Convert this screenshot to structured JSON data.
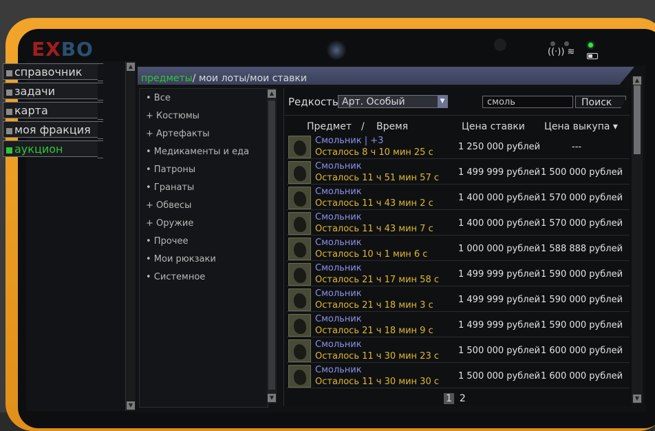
{
  "brand": {
    "logo_text_1": "EX",
    "logo_text_2": "BO"
  },
  "nav": {
    "items": [
      {
        "label": "справочник",
        "active": false
      },
      {
        "label": "задачи",
        "active": false
      },
      {
        "label": "карта",
        "active": false
      },
      {
        "label": "моя фракция",
        "active": false
      },
      {
        "label": "аукцион",
        "active": true
      }
    ]
  },
  "tabs": {
    "items": "предметы",
    "my_lots": "мои лоты",
    "my_bids": "мои ставки",
    "separator": "/"
  },
  "categories": [
    "• Все",
    "+ Костюмы",
    "+ Артефакты",
    "• Медикаменты и еда",
    "• Патроны",
    "• Гранаты",
    "+ Обвесы",
    "+ Оружие",
    "• Прочее",
    "• Мои рюкзаки",
    "• Системное"
  ],
  "filters": {
    "rarity_label": "Редкость",
    "rarity_value": "Арт. Особый",
    "search_value": "смоль",
    "search_button": "Поиск"
  },
  "table": {
    "headers": {
      "item": "Предмет",
      "slash": "/",
      "time": "Время",
      "bid": "Цена ставки",
      "buyout": "Цена выкупа ▾"
    },
    "rows": [
      {
        "name": "Смольник | +3",
        "time": "Осталось 8 ч 10 мин 25 с",
        "bid": "1 250 000 рублей",
        "buyout": "---"
      },
      {
        "name": "Смольник",
        "time": "Осталось 11 ч 51 мин 57 с",
        "bid": "1 499 999 рублей",
        "buyout": "1 500 000 рублей"
      },
      {
        "name": "Смольник",
        "time": "Осталось 11 ч 43 мин 2 с",
        "bid": "1 400 000 рублей",
        "buyout": "1 570 000 рублей"
      },
      {
        "name": "Смольник",
        "time": "Осталось 11 ч 43 мин 7 с",
        "bid": "1 400 000 рублей",
        "buyout": "1 570 000 рублей"
      },
      {
        "name": "Смольник",
        "time": "Осталось 10 ч 1 мин 6 с",
        "bid": "1 000 000 рублей",
        "buyout": "1 588 888 рублей"
      },
      {
        "name": "Смольник",
        "time": "Осталось 21 ч 17 мин 58 с",
        "bid": "1 499 999 рублей",
        "buyout": "1 590 000 рублей"
      },
      {
        "name": "Смольник",
        "time": "Осталось 21 ч 18 мин 3 с",
        "bid": "1 499 999 рублей",
        "buyout": "1 590 000 рублей"
      },
      {
        "name": "Смольник",
        "time": "Осталось 21 ч 18 мин 9 с",
        "bid": "1 499 999 рублей",
        "buyout": "1 590 000 рублей"
      },
      {
        "name": "Смольник",
        "time": "Осталось 11 ч 30 мин 23 с",
        "bid": "1 500 000 рублей",
        "buyout": "1 600 000 рублей"
      },
      {
        "name": "Смольник",
        "time": "Осталось 11 ч 30 мин 30 с",
        "bid": "1 500 000 рублей",
        "buyout": "1 600 000 рублей"
      }
    ]
  },
  "pager": {
    "current": "1",
    "next": "2"
  },
  "colors": {
    "active_green": "#31c43b",
    "item_name": "#8b92ea",
    "time_left": "#e0b830",
    "frame_orange": "#f2a52a"
  }
}
